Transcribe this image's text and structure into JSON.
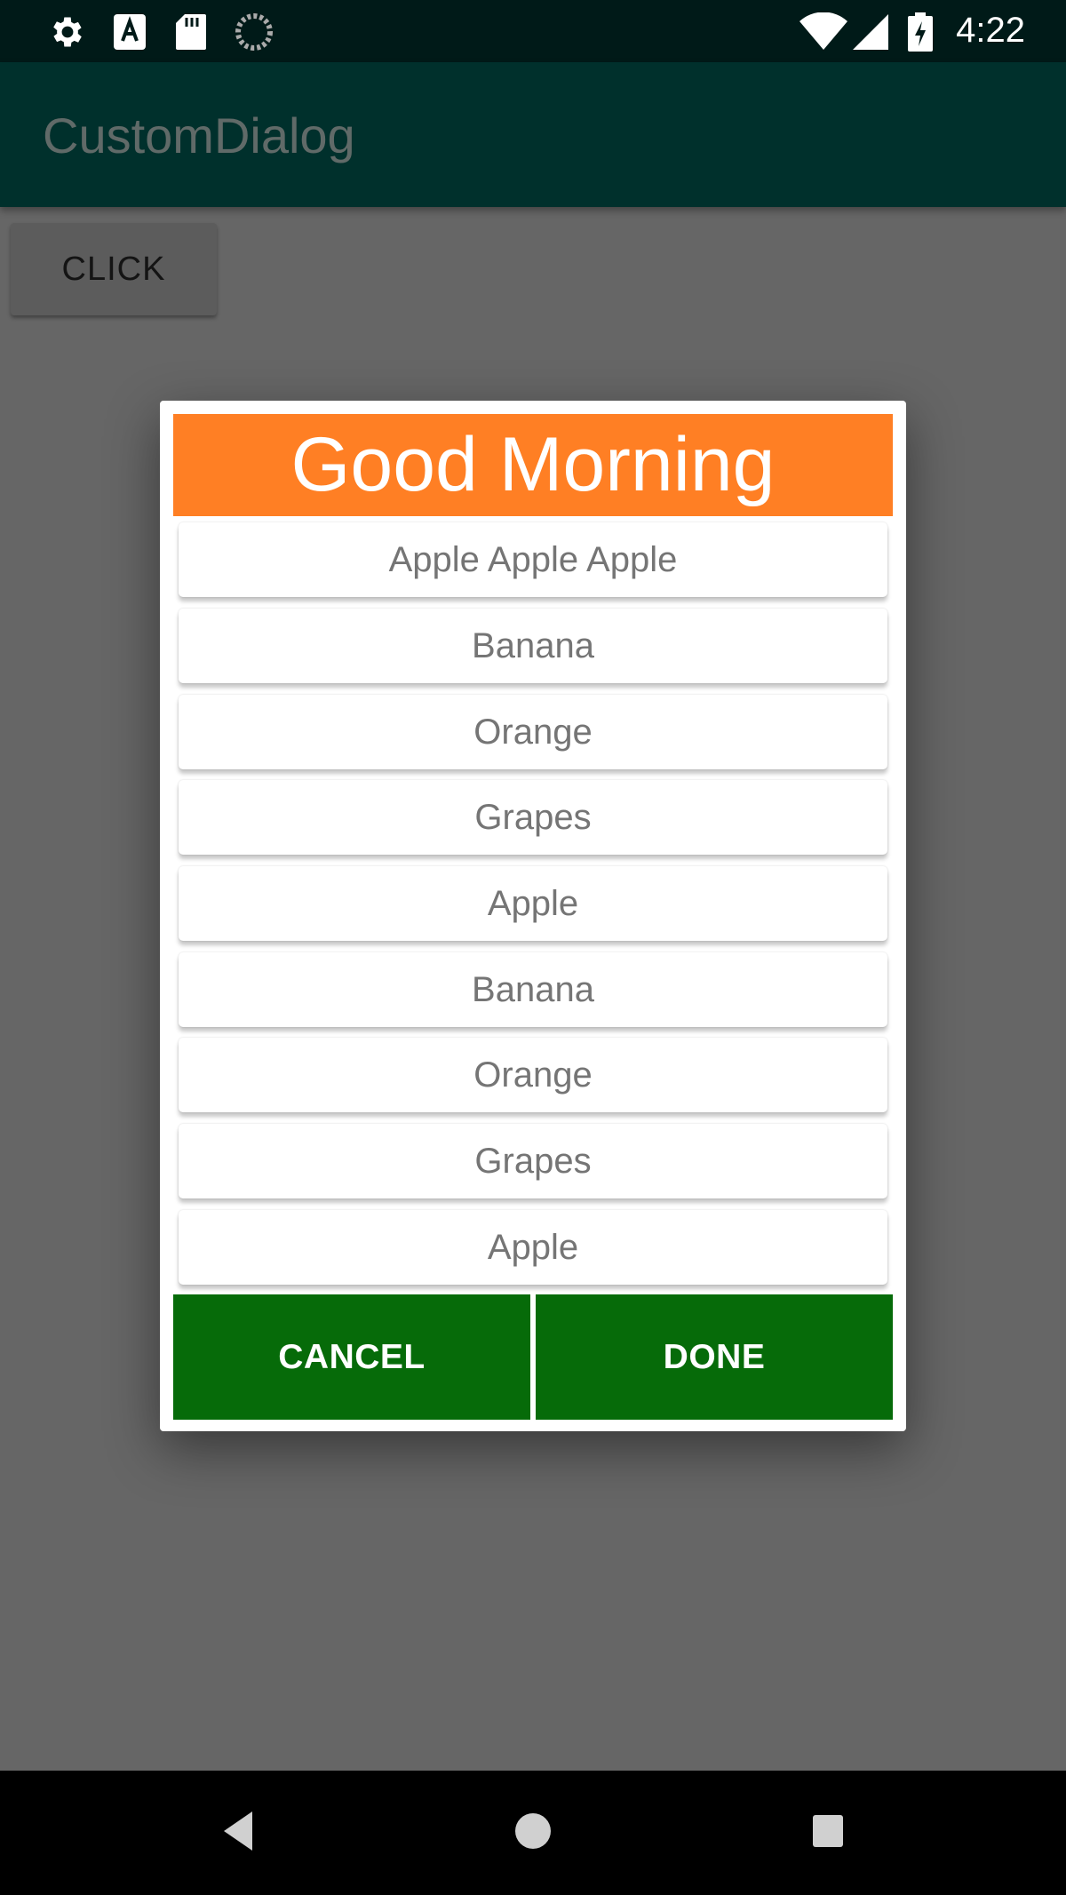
{
  "status_bar": {
    "time": "4:22",
    "left_icons": [
      "gear-icon",
      "font-a-icon",
      "sd-card-icon",
      "loading-icon"
    ],
    "right_icons": [
      "wifi-icon",
      "signal-icon",
      "battery-charging-icon"
    ]
  },
  "app_bar": {
    "title": "CustomDialog"
  },
  "main": {
    "click_button_label": "CLICK"
  },
  "dialog": {
    "title": "Good Morning",
    "items": [
      "Apple Apple Apple",
      "Banana",
      "Orange",
      "Grapes",
      "Apple",
      "Banana",
      "Orange",
      "Grapes",
      "Apple"
    ],
    "cancel_label": "CANCEL",
    "done_label": "DONE"
  },
  "colors": {
    "header": "#ff7f24",
    "buttons": "#066b09",
    "app_bar": "#00302c",
    "scrim": "#666666"
  },
  "nav_bar": {
    "icons": [
      "back-icon",
      "home-icon",
      "recents-icon"
    ]
  }
}
